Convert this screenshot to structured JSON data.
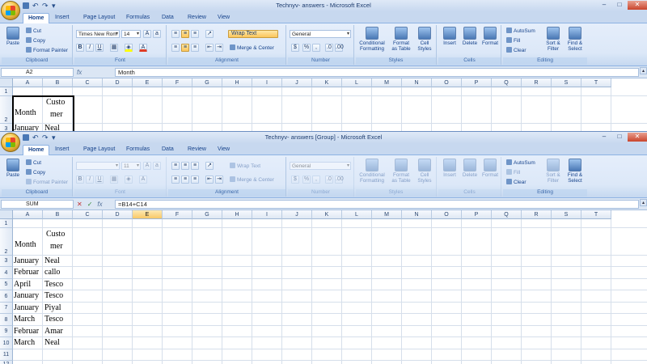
{
  "colors": {
    "ribbon": "#dce8f8",
    "accent": "#15428b",
    "selection": "#f8c867"
  },
  "windows": [
    {
      "title": "Technyv- answers - Microsoft Excel",
      "name_box": "A2",
      "formula": "Month",
      "font_name": "Times New Rom",
      "font_size": "14",
      "number_format": "General",
      "disabled": false
    },
    {
      "title": "Technyv- answers [Group] - Microsoft Excel",
      "name_box": "SUM",
      "formula": "=B14+C14",
      "font_name": "",
      "font_size": "11",
      "number_format": "General",
      "disabled": true
    }
  ],
  "tabs": [
    "Home",
    "Insert",
    "Page Layout",
    "Formulas",
    "Data",
    "Review",
    "View"
  ],
  "ribbon": {
    "clipboard": {
      "label": "Clipboard",
      "paste": "Paste",
      "cut": "Cut",
      "copy": "Copy",
      "format_painter": "Format Painter"
    },
    "font": {
      "label": "Font"
    },
    "alignment": {
      "label": "Alignment",
      "wrap_text": "Wrap Text",
      "merge_center": "Merge & Center"
    },
    "number": {
      "label": "Number",
      "currency": "$",
      "percent": "%",
      "comma": ","
    },
    "styles": {
      "label": "Styles",
      "conditional": "Conditional Formatting",
      "format_table": "Format as Table",
      "cell_styles": "Cell Styles"
    },
    "cells": {
      "label": "Cells",
      "insert": "Insert",
      "delete": "Delete",
      "format": "Format"
    },
    "editing": {
      "label": "Editing",
      "autosum": "AutoSum",
      "fill": "Fill",
      "clear": "Clear",
      "sort_filter": "Sort & Filter",
      "find_select": "Find & Select"
    }
  },
  "columns": [
    "A",
    "B",
    "C",
    "D",
    "E",
    "F",
    "G",
    "H",
    "I",
    "J",
    "K",
    "L",
    "M",
    "N",
    "O",
    "P",
    "Q",
    "R",
    "S",
    "T"
  ],
  "rows_top": [
    "1",
    "2",
    "3"
  ],
  "rows_bottom": [
    "1",
    "2",
    "3",
    "4",
    "5",
    "6",
    "7",
    "8",
    "9",
    "10",
    "11",
    "12"
  ],
  "header": {
    "month": "Month",
    "customer_line1": "Custo",
    "customer_line2": "mer"
  },
  "data_rows": [
    {
      "month": "January",
      "customer": "Neal"
    },
    {
      "month": "Februar",
      "customer": "callo"
    },
    {
      "month": "April",
      "customer": "Tesco"
    },
    {
      "month": "January",
      "customer": "Tesco"
    },
    {
      "month": "January",
      "customer": "Piyal"
    },
    {
      "month": "March",
      "customer": "Tesco"
    },
    {
      "month": "Februar",
      "customer": "Amar"
    },
    {
      "month": "March",
      "customer": "Neal"
    }
  ]
}
